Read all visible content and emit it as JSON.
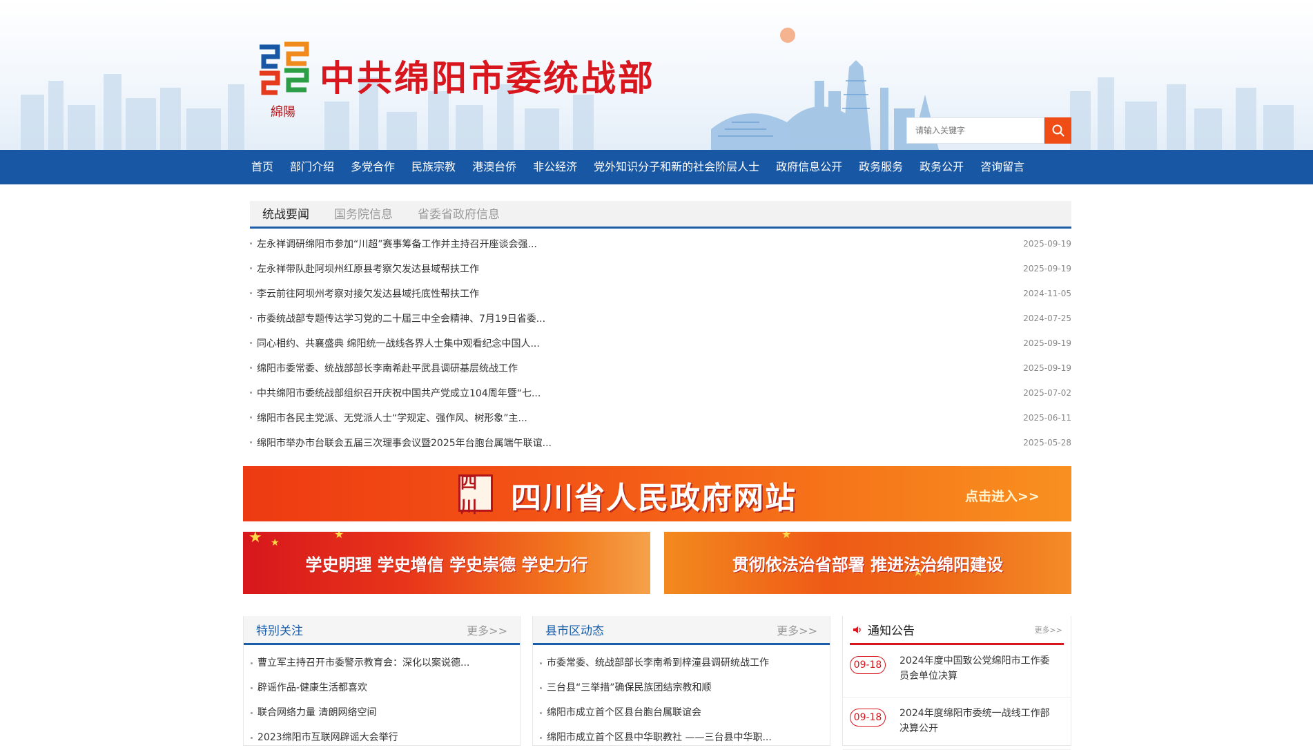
{
  "header": {
    "site_title": "中共绵阳市委统战部",
    "logo_text": "綿陽",
    "search_placeholder": "请输入关键字"
  },
  "nav": {
    "items": [
      "首页",
      "部门介绍",
      "多党合作",
      "民族宗教",
      "港澳台侨",
      "非公经济",
      "党外知识分子和新的社会阶层人士",
      "政府信息公开",
      "政务服务",
      "政务公开",
      "咨询留言"
    ]
  },
  "news": {
    "tabs": [
      "统战要闻",
      "国务院信息",
      "省委省政府信息"
    ],
    "items": [
      {
        "title": "左永祥调研绵阳市参加“川超”赛事筹备工作并主持召开座谈会强...",
        "date": "2025-09-19"
      },
      {
        "title": "左永祥带队赴阿坝州红原县考察欠发达县域帮扶工作",
        "date": "2025-09-19"
      },
      {
        "title": "李云前往阿坝州考察对接欠发达县域托底性帮扶工作",
        "date": "2024-11-05"
      },
      {
        "title": "市委统战部专题传达学习党的二十届三中全会精神、7月19日省委...",
        "date": "2024-07-25"
      },
      {
        "title": "同心相约、共襄盛典 绵阳统一战线各界人士集中观看纪念中国人...",
        "date": "2025-09-19"
      },
      {
        "title": "绵阳市委常委、统战部部长李南希赴平武县调研基层统战工作",
        "date": "2025-09-19"
      },
      {
        "title": "中共绵阳市委统战部组织召开庆祝中国共产党成立104周年暨“七...",
        "date": "2025-07-02"
      },
      {
        "title": "绵阳市各民主党派、无党派人士“学规定、强作风、树形象”主...",
        "date": "2025-06-11"
      },
      {
        "title": "绵阳市举办市台联会五届三次理事会议暨2025年台胞台属端午联谊...",
        "date": "2025-05-28"
      }
    ]
  },
  "banners": {
    "main_title": "四川省人民政府网站",
    "main_enter": "点击进入>>",
    "main_seal": "四川",
    "left_text": "学史明理 学史增信 学史崇德 学史力行",
    "right_text": "贯彻依法治省部署 推进法治绵阳建设"
  },
  "panels": {
    "special": {
      "title": "特别关注",
      "more": "更多>>",
      "items": [
        "曹立军主持召开市委警示教育会：深化以案说德...",
        "辟谣作品-健康生活都喜欢",
        "联合网络力量 清朗网络空间",
        "2023绵阳市互联网辟谣大会举行"
      ]
    },
    "county": {
      "title": "县市区动态",
      "more": "更多>>",
      "items": [
        "市委常委、统战部部长李南希到梓潼县调研统战工作",
        "三台县“三举措”确保民族团结宗教和顺",
        "绵阳市成立首个区县台胞台属联谊会",
        "绵阳市成立首个区县中华职教社 ——三台县中华职..."
      ]
    },
    "notice": {
      "title": "通知公告",
      "more": "更多>>",
      "items": [
        {
          "date": "09-18",
          "title": "2024年度中国致公党绵阳市工作委员会单位决算"
        },
        {
          "date": "09-18",
          "title": "2024年度绵阳市委统一战线工作部决算公开"
        }
      ]
    }
  },
  "colors": {
    "nav_bg": "#1857a4",
    "title_red": "#d7161e",
    "search_btn": "#f04d16",
    "tab_underline": "#1a5eaa"
  }
}
